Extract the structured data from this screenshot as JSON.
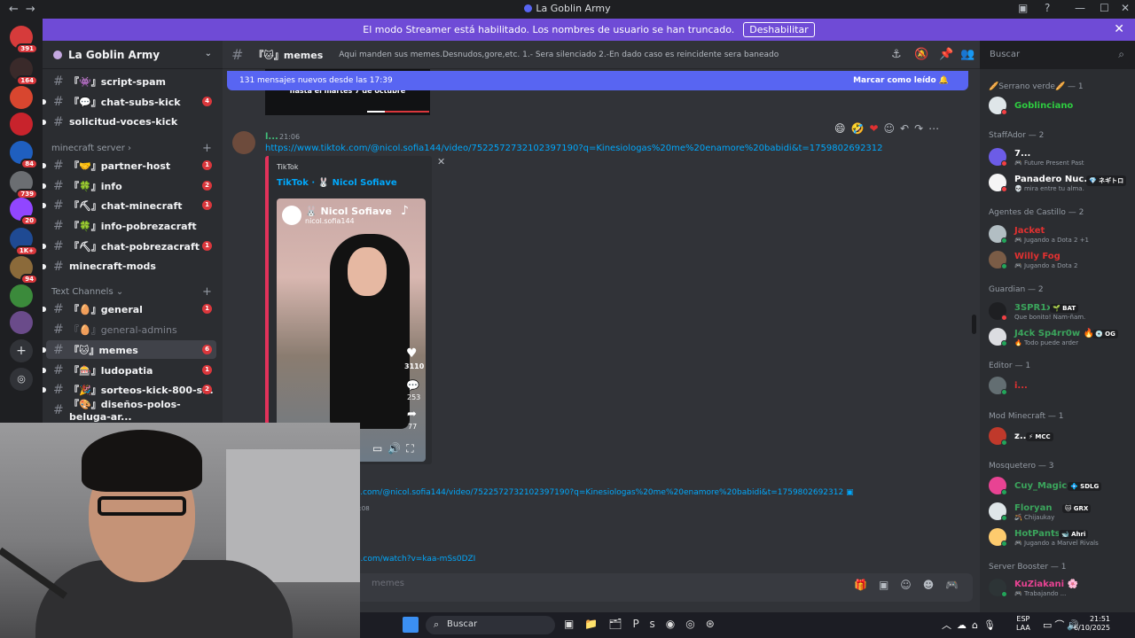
{
  "window": {
    "title": "La Goblin Army",
    "nav_back": "←",
    "nav_fwd": "→"
  },
  "banner": {
    "text": "El modo Streamer está habilitado. Los nombres de usuario se han truncado.",
    "button": "Deshabilitar"
  },
  "servers": [
    {
      "badge": "391",
      "color": "#d63b3b"
    },
    {
      "badge": "164",
      "color": "#3a2a2a"
    },
    {
      "badge": "",
      "color": "#d8462f"
    },
    {
      "badge": "",
      "color": "#c8232c"
    },
    {
      "badge": "84",
      "color": "#1f5fbf"
    },
    {
      "badge": "739",
      "color": "#6b6e72"
    },
    {
      "badge": "20",
      "color": "#9146ff"
    },
    {
      "badge": "1K+",
      "color": "#1f4a93"
    },
    {
      "badge": "94",
      "color": "#8b6a3a"
    },
    {
      "badge": "",
      "color": "#3b8a3b"
    },
    {
      "badge": "",
      "color": "#6a4b8a"
    }
  ],
  "sidebar": {
    "guild_name": "La Goblin Army",
    "cat_minecraft": "minecraft server",
    "cat_text": "Text Channels",
    "channels": [
      {
        "name": "『👾』script-spam",
        "badge": ""
      },
      {
        "name": "『💬』chat-subs-kick",
        "badge": "4"
      },
      {
        "name": "solicitud-voces-kick",
        "badge": ""
      },
      {
        "name": "『🤝』partner-host",
        "badge": "1"
      },
      {
        "name": "『🍀』info",
        "badge": "2"
      },
      {
        "name": "『⛏』chat-minecraft",
        "badge": "1"
      },
      {
        "name": "『🍀』info-pobrezacraft",
        "badge": ""
      },
      {
        "name": "『⛏』chat-pobrezacraft",
        "badge": "1"
      },
      {
        "name": "minecraft-mods",
        "badge": ""
      },
      {
        "name": "『🥚』general",
        "badge": "1"
      },
      {
        "name": "『🥚』general-admins",
        "badge": ""
      },
      {
        "name": "『🐱』memes",
        "badge": "6"
      },
      {
        "name": "『🎰』ludopatia",
        "badge": "1"
      },
      {
        "name": "『🎉』sorteos-kick-800-s...",
        "badge": "2"
      },
      {
        "name": "『🎨』diseños-polos-beluga-ar...",
        "badge": ""
      }
    ]
  },
  "header": {
    "channel": "『🐱』memes",
    "topic": "Aqui manden sus memes.Desnudos,gore,etc. 1.- Sera silenciado 2.-En dado caso es reincidente sera baneado",
    "search_placeholder": "Buscar"
  },
  "chat": {
    "new_messages": "131 mensajes nuevos desde las 17:39",
    "mark_read": "Marcar como leído",
    "prev_embed_text": "hasta el martes 7 de octubre",
    "msg1_author": "l...",
    "msg1_time": "21:06",
    "msg1_link": "https://www.tiktok.com/@nicol.sofia144/video/7522572732102397190?q=Kinesiologas%20me%20enamore%20babidi&t=1759802692312",
    "embed_provider": "TikTok",
    "embed_title": "TikTok · 🐰 Nicol Sofiave",
    "video_name": "🐰 Nicol Sofiave",
    "video_handle": "nicol.sofia144",
    "video_likes": "3110",
    "video_comments": "253",
    "video_shares": "77",
    "msg2_link": "k.com/@nicol.sofia144/video/7522572732102397190?q=Kinesiologas%20me%20enamore%20babidi&t=1759802692312",
    "msg2_time": "1:08",
    "msg3_link": "e.com/watch?v=kaa-mSs0DZI",
    "composer_placeholder": "memes"
  },
  "members": {
    "groups": [
      {
        "label": "🥖Serrano verde🥖 — 1"
      },
      {
        "label": "StaffAdor — 2"
      },
      {
        "label": "Agentes de Castillo — 2"
      },
      {
        "label": "Guardian — 2"
      },
      {
        "label": "Editor — 1"
      },
      {
        "label": "Mod Minecraft — 1"
      },
      {
        "label": "Mosquetero — 3"
      },
      {
        "label": "Server Booster — 1"
      }
    ],
    "people": [
      {
        "name": "Goblinciano",
        "sub": "",
        "tag": "",
        "color": "#2ecc40",
        "status": "#f23f43",
        "av": "#dfe6e9"
      },
      {
        "name": "7...",
        "sub": "🎮 Future Present Past",
        "tag": "",
        "color": "#ffffff",
        "status": "#f23f43",
        "av": "#6c5ce7"
      },
      {
        "name": "Panadero Nuc...",
        "sub": "💀 mira entre tu alma.",
        "tag": "💎 ネギトロ",
        "color": "#ffffff",
        "status": "#f23f43",
        "av": "#f5f5f5"
      },
      {
        "name": "Jacket",
        "sub": "🎮 Jugando a Dota 2 +1",
        "tag": "",
        "color": "#e03131",
        "status": "#23a55a",
        "av": "#b2bec3"
      },
      {
        "name": "Willy Fog",
        "sub": "🎮 Jugando a Dota 2",
        "tag": "",
        "color": "#e03131",
        "status": "#23a55a",
        "av": "#7a5c46"
      },
      {
        "name": "3SPR1xs",
        "sub": "Que bonito! Nam-ñam.",
        "tag": "🌱 BAT",
        "color": "#3ba55c",
        "status": "#f23f43",
        "av": "#1e1f22"
      },
      {
        "name": "J4ck Sp4rr0w 🔥",
        "sub": "🔥 Todo puede arder",
        "tag": "💿 OG",
        "color": "#3ba55c",
        "status": "#23a55a",
        "av": "#dcdde1"
      },
      {
        "name": "i...",
        "sub": "",
        "tag": "",
        "color": "#e03131",
        "status": "#23a55a",
        "av": "#636e72"
      },
      {
        "name": "z...",
        "sub": "",
        "tag": "⚡ MCC",
        "color": "#ffffff",
        "status": "#23a55a",
        "av": "#c0392b"
      },
      {
        "name": "Cuy_Magico",
        "sub": "",
        "tag": "💠 SDLG",
        "color": "#3ba55c",
        "status": "#23a55a",
        "av": "#e84393"
      },
      {
        "name": "Floryan",
        "sub": "🪃 Chijaukay",
        "tag": "🐱 GRX",
        "color": "#3ba55c",
        "status": "#23a55a",
        "av": "#dfe6e9"
      },
      {
        "name": "HotPants",
        "sub": "🎮 Jugando a Marvel Rivals",
        "tag": "🐋 Ahri",
        "color": "#3ba55c",
        "status": "#23a55a",
        "av": "#fdcb6e"
      },
      {
        "name": "KuZiakani 🌸",
        "sub": "🎮 Trabajando ...",
        "tag": "",
        "color": "#e84393",
        "status": "#23a55a",
        "av": "#2d3436"
      }
    ]
  },
  "taskbar": {
    "search": "Buscar",
    "lang1": "ESP",
    "lang2": "LAA",
    "time": "21:51",
    "date": "6/10/2025"
  }
}
